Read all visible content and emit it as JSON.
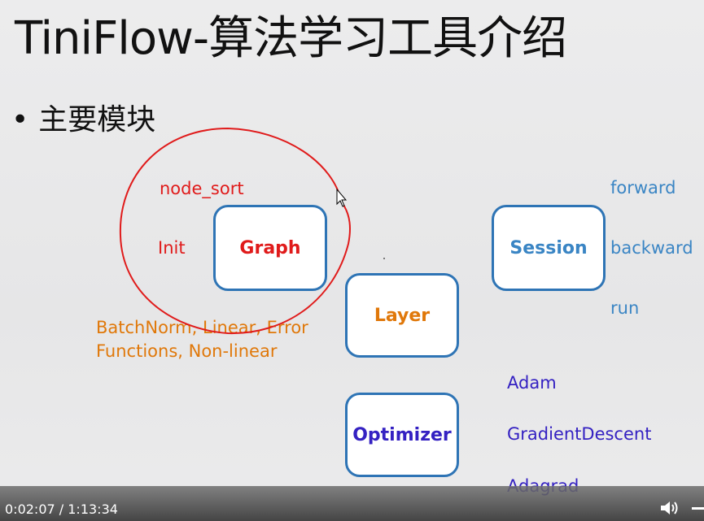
{
  "slide": {
    "title": "TiniFlow-算法学习工具介绍",
    "bullet": "主要模块",
    "bullet_marker": "•"
  },
  "modules": {
    "graph": "Graph",
    "layer": "Layer",
    "session": "Session",
    "optimizer": "Optimizer"
  },
  "graph_notes": {
    "node_sort": "node_sort",
    "init": "Init"
  },
  "layer_notes": {
    "line1": "BatchNorm, Linear, Error",
    "line2": "Functions, Non-linear"
  },
  "session_notes": {
    "forward": "forward",
    "backward": "backward",
    "run": "run"
  },
  "optimizer_notes": {
    "adam": "Adam",
    "gd": "GradientDescent",
    "adagrad": "Adagrad"
  },
  "player": {
    "time": "0:02:07 / 1:13:34",
    "volume_icon": "speaker-icon"
  },
  "colors": {
    "box_border": "#2e74b5",
    "red": "#e01b1b",
    "blue": "#3a85c4",
    "orange": "#e0780a",
    "purple": "#3421c2"
  }
}
